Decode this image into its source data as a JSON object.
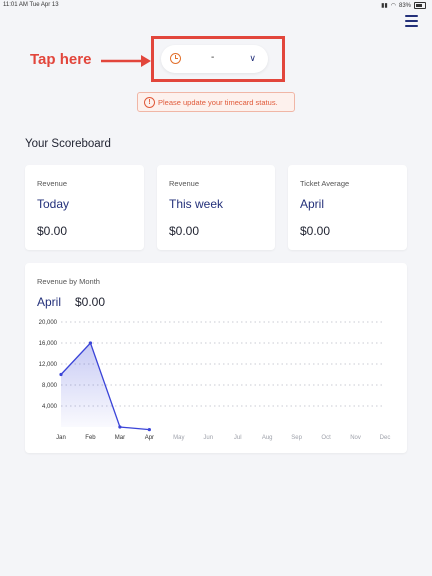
{
  "status_bar": {
    "time": "11:01 AM   Tue Apr 13",
    "battery": "83%"
  },
  "annotation": {
    "label": "Tap here"
  },
  "timecard": {
    "status": "-"
  },
  "alert": {
    "icon": "!",
    "text": "Please update your timecard status."
  },
  "scoreboard": {
    "title": "Your Scoreboard",
    "cards": [
      {
        "label": "Revenue",
        "period": "Today",
        "amount": "$0.00"
      },
      {
        "label": "Revenue",
        "period": "This week",
        "amount": "$0.00"
      },
      {
        "label": "Ticket Average",
        "period": "April",
        "amount": "$0.00"
      }
    ]
  },
  "revenue_chart": {
    "label": "Revenue by Month",
    "month": "April",
    "total": "$0.00"
  },
  "colors": {
    "accent": "#23307a",
    "annotation": "#e2463c",
    "line": "#3a44d8",
    "warning": "#e05a3a"
  },
  "chart_data": {
    "type": "area",
    "categories": [
      "Jan",
      "Feb",
      "Mar",
      "Apr",
      "May",
      "Jun",
      "Jul",
      "Aug",
      "Sep",
      "Oct",
      "Nov",
      "Dec"
    ],
    "values": [
      10000,
      16000,
      0,
      -500,
      null,
      null,
      null,
      null,
      null,
      null,
      null,
      null
    ],
    "yticks": [
      4000,
      8000,
      12000,
      16000,
      20000
    ],
    "ytick_labels": [
      "4,000",
      "8,000",
      "12,000",
      "16,000",
      "20,000"
    ],
    "ylim": [
      0,
      20000
    ],
    "grid": true
  }
}
